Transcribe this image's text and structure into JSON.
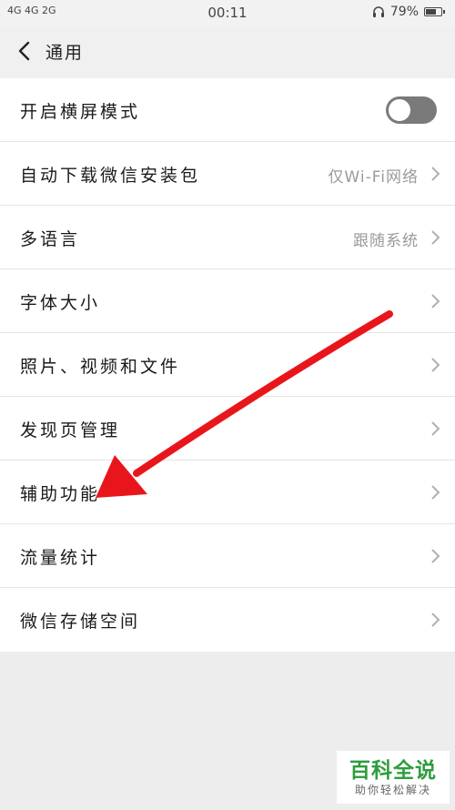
{
  "status_bar": {
    "left": "4G 4G 2G",
    "time": "00:11",
    "battery": "79%",
    "battery_fraction": 0.79
  },
  "nav": {
    "title": "通用"
  },
  "settings": [
    {
      "label": "开启横屏模式",
      "value": "",
      "control": "toggle",
      "on": false
    },
    {
      "label": "自动下载微信安装包",
      "value": "仅Wi-Fi网络",
      "control": "chevron"
    },
    {
      "label": "多语言",
      "value": "跟随系统",
      "control": "chevron"
    },
    {
      "label": "字体大小",
      "value": "",
      "control": "chevron"
    },
    {
      "label": "照片、视频和文件",
      "value": "",
      "control": "chevron"
    },
    {
      "label": "发现页管理",
      "value": "",
      "control": "chevron"
    },
    {
      "label": "辅助功能",
      "value": "",
      "control": "chevron"
    },
    {
      "label": "流量统计",
      "value": "",
      "control": "chevron"
    },
    {
      "label": "微信存储空间",
      "value": "",
      "control": "chevron"
    }
  ],
  "annotation": {
    "arrow_color": "#e8161b"
  },
  "watermark": {
    "title": "百科全说",
    "subtitle": "助你轻松解决"
  },
  "colors": {
    "background": "#ededed",
    "toggle_off": "#7a7a7a",
    "watermark_green": "#2e9d3e"
  }
}
